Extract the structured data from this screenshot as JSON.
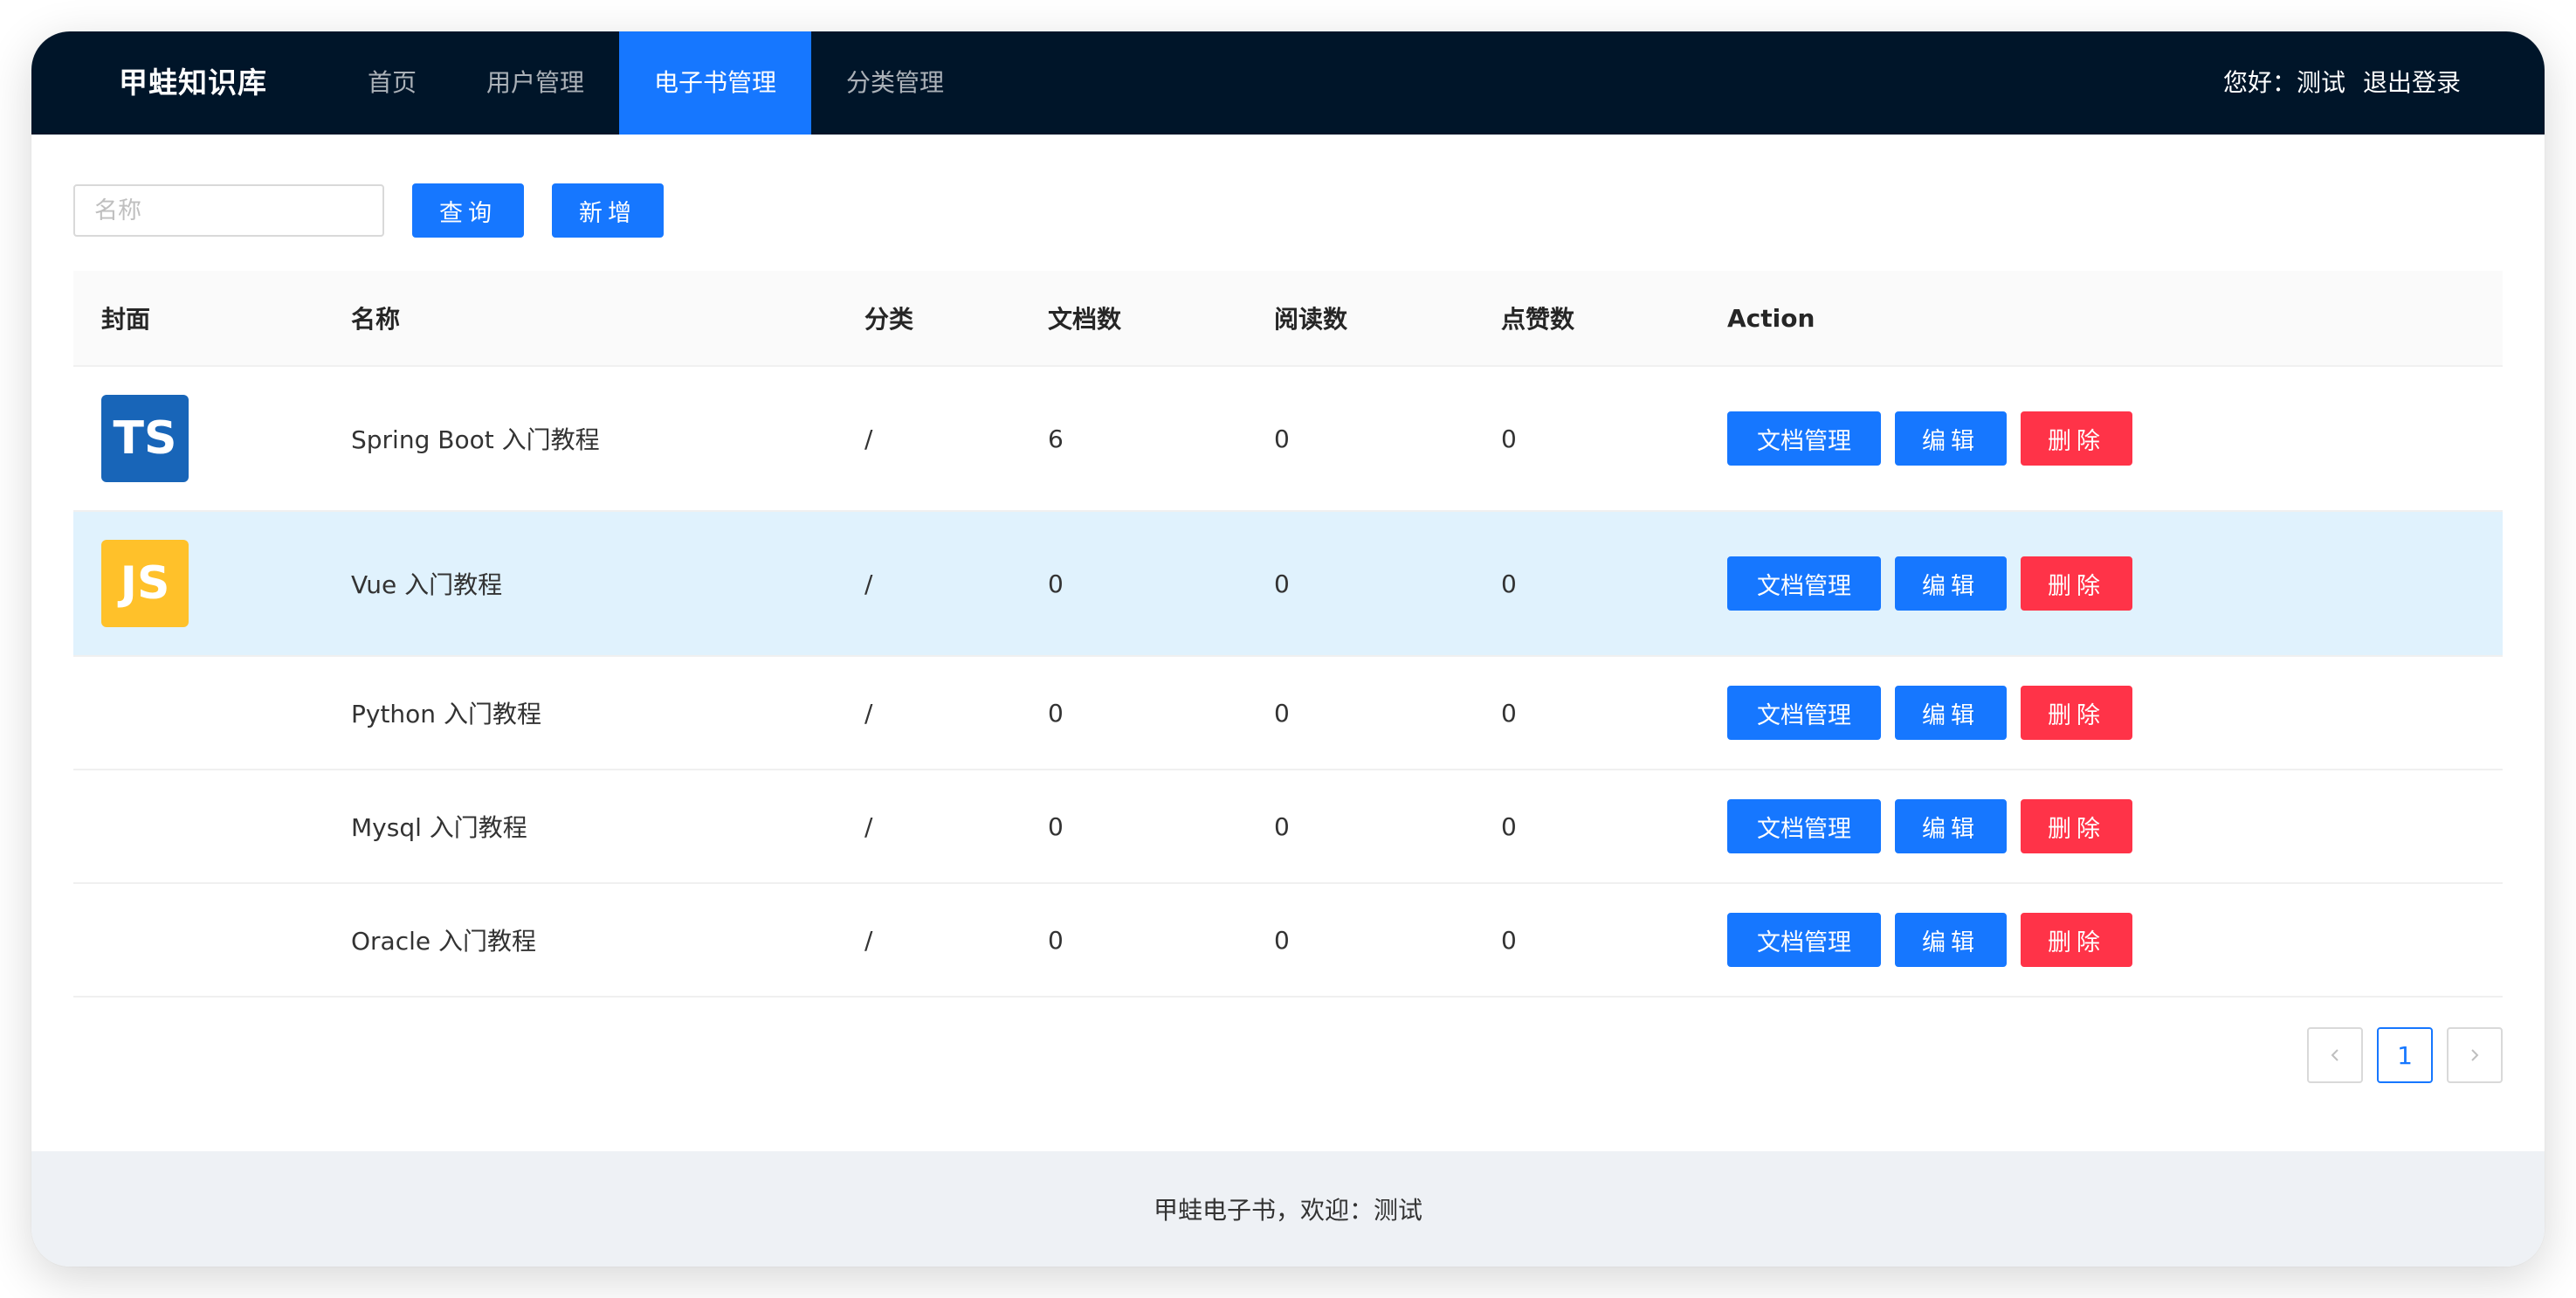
{
  "header": {
    "logo": "甲蛙知识库",
    "nav": [
      {
        "label": "首页",
        "active": false
      },
      {
        "label": "用户管理",
        "active": false
      },
      {
        "label": "电子书管理",
        "active": true
      },
      {
        "label": "分类管理",
        "active": false
      }
    ],
    "greeting": "您好：测试",
    "logout": "退出登录"
  },
  "toolbar": {
    "search_placeholder": "名称",
    "search_value": "",
    "query_label": "查询",
    "add_label": "新增"
  },
  "table": {
    "columns": [
      "封面",
      "名称",
      "分类",
      "文档数",
      "阅读数",
      "点赞数",
      "Action"
    ],
    "rows": [
      {
        "cover": "TS",
        "cover_bg": "#1865b8",
        "name": "Spring Boot 入门教程",
        "category": "/",
        "doc_count": "6",
        "view_count": "0",
        "vote_count": "0"
      },
      {
        "cover": "JS",
        "cover_bg": "#ffc12a",
        "name": "Vue 入门教程",
        "category": "/",
        "doc_count": "0",
        "view_count": "0",
        "vote_count": "0"
      },
      {
        "cover": "",
        "name": "Python 入门教程",
        "category": "/",
        "doc_count": "0",
        "view_count": "0",
        "vote_count": "0"
      },
      {
        "cover": "",
        "name": "Mysql 入门教程",
        "category": "/",
        "doc_count": "0",
        "view_count": "0",
        "vote_count": "0"
      },
      {
        "cover": "",
        "name": "Oracle 入门教程",
        "category": "/",
        "doc_count": "0",
        "view_count": "0",
        "vote_count": "0"
      }
    ],
    "actions": {
      "doc_manage": "文档管理",
      "edit": "编辑",
      "delete": "删除"
    }
  },
  "pagination": {
    "prev": "<",
    "current": "1",
    "next": ">"
  },
  "footer": {
    "text": "甲蛙电子书，欢迎：测试"
  },
  "colors": {
    "header_bg": "#001529",
    "primary": "#1677ff",
    "danger": "#ff3348",
    "highlight_row": "#e0f2fd",
    "footer_bg": "#eef1f5"
  }
}
